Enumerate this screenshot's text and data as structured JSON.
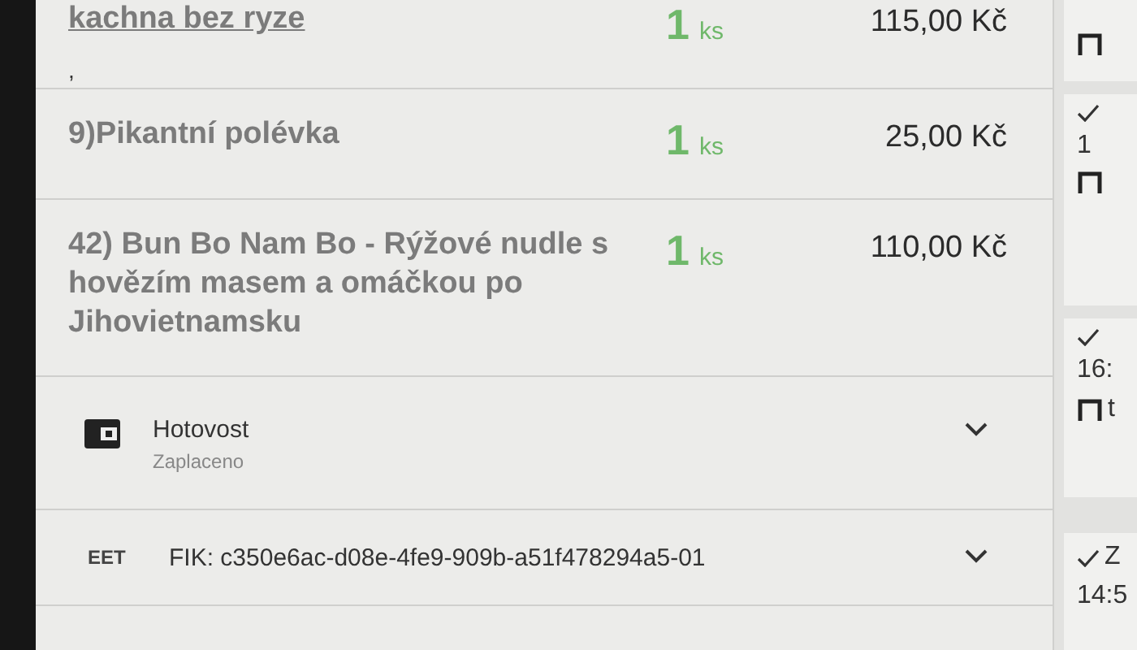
{
  "items": [
    {
      "name": "kachna bez ryze",
      "underlined": true,
      "qty": "1",
      "unit": "ks",
      "price": "115,00 Kč",
      "note": ","
    },
    {
      "name": "9)Pikantní polévka",
      "underlined": false,
      "qty": "1",
      "unit": "ks",
      "price": "25,00 Kč"
    },
    {
      "name": "42) Bun Bo Nam Bo - Rýžové nudle s hovězím masem a omáčkou po Jihovietnamsku",
      "underlined": false,
      "qty": "1",
      "unit": "ks",
      "price": "110,00 Kč"
    }
  ],
  "payment": {
    "method": "Hotovost",
    "status": "Zaplaceno",
    "expanded": false
  },
  "eet": {
    "label": "EET",
    "fik": "FIK: c350e6ac-d08e-4fe9-909b-a51f478294a5-01",
    "expanded": false
  },
  "side_cards": [
    {
      "kind": "top"
    },
    {
      "kind": "order",
      "checked": true,
      "time": "1"
    },
    {
      "kind": "order",
      "checked": true,
      "time": "16:",
      "tag": "t"
    },
    {
      "kind": "order",
      "checked": true,
      "status": "Z",
      "time": "14:5"
    }
  ]
}
